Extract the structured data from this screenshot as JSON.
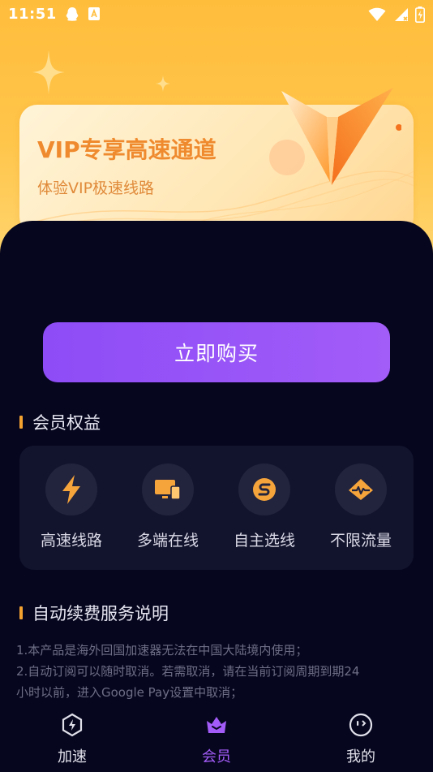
{
  "status_bar": {
    "time": "11:51"
  },
  "banner": {
    "title": "VIP专享高速通道",
    "subtitle": "体验VIP极速线路"
  },
  "buy_button": {
    "label": "立即购买"
  },
  "benefits": {
    "title": "会员权益",
    "items": [
      {
        "label": "高速线路",
        "icon": "lightning-icon"
      },
      {
        "label": "多端在线",
        "icon": "multi-device-icon"
      },
      {
        "label": "自主选线",
        "icon": "route-select-icon"
      },
      {
        "label": "不限流量",
        "icon": "unlimited-traffic-icon"
      }
    ]
  },
  "renewal": {
    "title": "自动续费服务说明",
    "lines": [
      "1.本产品是海外回国加速器无法在中国大陆境内使用；",
      "2.自动订阅可以随时取消。若需取消，请在当前订阅周期到期24",
      "小时以前，进入Google Pay设置中取消；"
    ]
  },
  "tabs": [
    {
      "label": "加速",
      "icon": "speed-icon",
      "active": false
    },
    {
      "label": "会员",
      "icon": "crown-icon",
      "active": true
    },
    {
      "label": "我的",
      "icon": "profile-icon",
      "active": false
    }
  ],
  "colors": {
    "accent": "#a35cf7",
    "orange": "#ef8a2e",
    "panel": "#06061f"
  }
}
